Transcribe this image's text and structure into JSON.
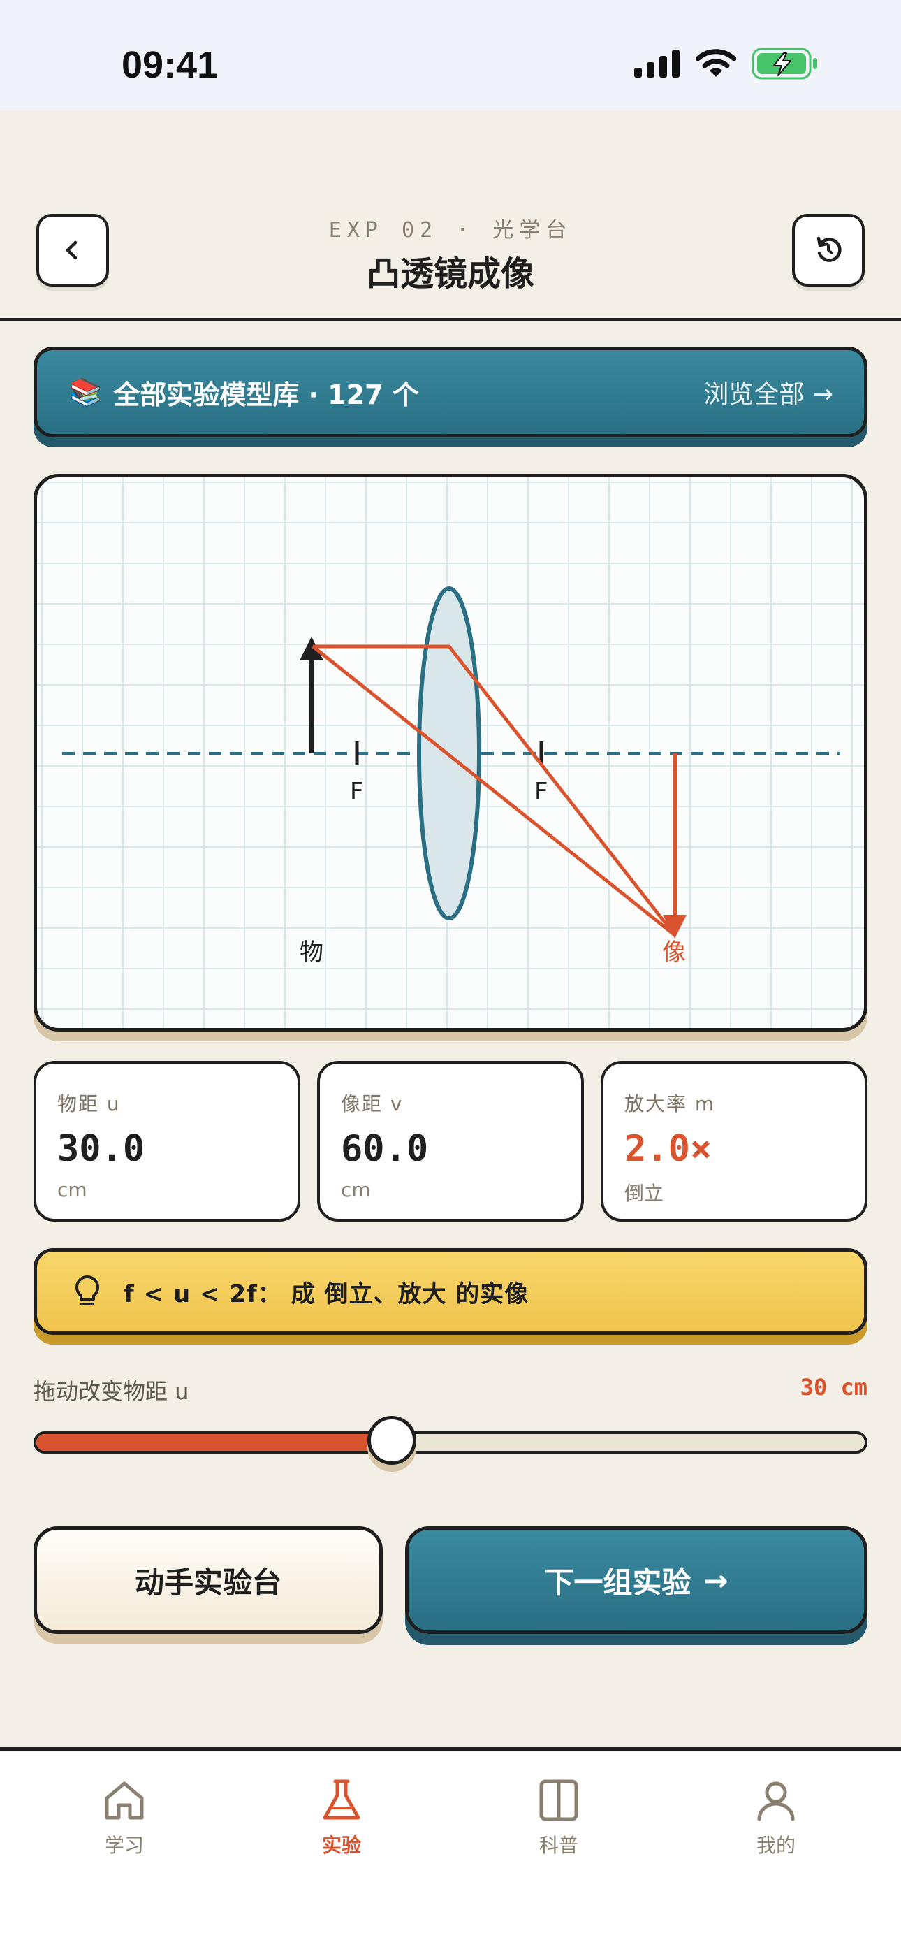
{
  "status_bar": {
    "time": "09:41"
  },
  "header": {
    "subtitle": "EXP 02 · 光学台",
    "title": "凸透镜成像"
  },
  "library_banner": {
    "emoji": "📚",
    "label": "全部实验模型库 · 127 个",
    "action": "浏览全部 →"
  },
  "optics": {
    "focal_label": "F",
    "object_label": "物",
    "image_label": "像"
  },
  "metrics": [
    {
      "label": "物距  u",
      "value": "30.0",
      "unit": "cm"
    },
    {
      "label": "像距  v",
      "value": "60.0",
      "unit": "cm"
    },
    {
      "label": "放大率  m",
      "value": "2.0×",
      "unit": "倒立"
    }
  ],
  "hint": {
    "text": "f < u < 2f： 成 倒立、放大 的实像"
  },
  "slider": {
    "label": "拖动改变物距  u",
    "value_text": "30 cm",
    "fraction": 0.43
  },
  "actions": {
    "secondary": "动手实验台",
    "primary": "下一组实验",
    "primary_arrow": "→"
  },
  "tabs": [
    {
      "label": "学习",
      "icon": "home-icon"
    },
    {
      "label": "实验",
      "icon": "flask-icon"
    },
    {
      "label": "科普",
      "icon": "book-icon"
    },
    {
      "label": "我的",
      "icon": "user-icon"
    }
  ],
  "colors": {
    "accent": "#d9542e",
    "teal": "#2a6f83",
    "yellow": "#f1c44e",
    "background": "#f4efe6"
  }
}
